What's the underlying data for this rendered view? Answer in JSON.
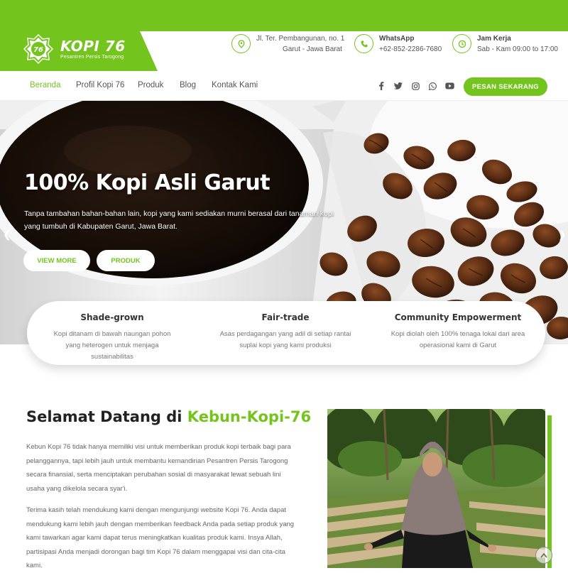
{
  "brand": {
    "name": "KOPI 76",
    "tagline": "Pesantren Persis Tarogong",
    "badge_text": "76",
    "accent": "#73c41d"
  },
  "contact": {
    "address_line1": "Jl. Ter. Pembangunan, no. 1",
    "address_line2": "Garut - Jawa Barat",
    "whatsapp_label": "WhatsApp",
    "whatsapp_number": "+62-852-2286-7680",
    "hours_label": "Jam Kerja",
    "hours_value": "Sab - Kam 09:00 to 17:00"
  },
  "nav": {
    "items": [
      "Beranda",
      "Profil Kopi 76",
      "Produk",
      "Blog",
      "Kontak Kami"
    ],
    "active": "Beranda",
    "social_icons": [
      "facebook-icon",
      "twitter-icon",
      "instagram-icon",
      "whatsapp-icon",
      "youtube-icon"
    ],
    "cta_label": "PESAN SEKARANG"
  },
  "hero": {
    "title": "100% Kopi Asli Garut",
    "description": "Tanpa tambahan bahan-bahan lain, kopi yang kami sediakan murni berasal dari tanaman kopi yang tumbuh di Kabupaten Garut, Jawa Barat.",
    "button_primary": "VIEW MORE",
    "button_secondary": "PRODUK"
  },
  "features": [
    {
      "title": "Shade-grown",
      "desc": "Kopi ditanam di bawah naungan pohon yang heterogen untuk menjaga sustainabilitas"
    },
    {
      "title": "Fair-trade",
      "desc": "Asas perdagangan yang adil di setiap rantai suplai kopi yang kami produksi"
    },
    {
      "title": "Community Empowerment",
      "desc": "Kopi diolah oleh 100% tenaga lokal dari area operasional kami di Garut"
    }
  ],
  "welcome": {
    "title_prefix": "Selamat Datang di ",
    "title_highlight": "Kebun-Kopi-76",
    "para1": "Kebun Kopi 76 tidak hanya memiliki visi untuk memberikan produk kopi terbaik bagi para pelanggannya, tapi lebih jauh untuk membantu kemandirian Pesantren Persis Tarogong secara finansial, serta menciptakan perubahan sosial di masyarakat lewat sebuah lini usaha yang dikelola secara syar'i.",
    "para2": "Terima kasih telah mendukung kami dengan mengunjungi website Kopi 76. Anda dapat mendukung kami lebih jauh dengan memberikan feedback Anda pada setiap produk yang kami tawarkan agar kami dapat terus meningkatkan kualitas produk kami. Insya Allah, partisipasi Anda menjadi dorongan bagi tim Kopi 76 dalam menggapai visi dan cita-cita kami."
  }
}
